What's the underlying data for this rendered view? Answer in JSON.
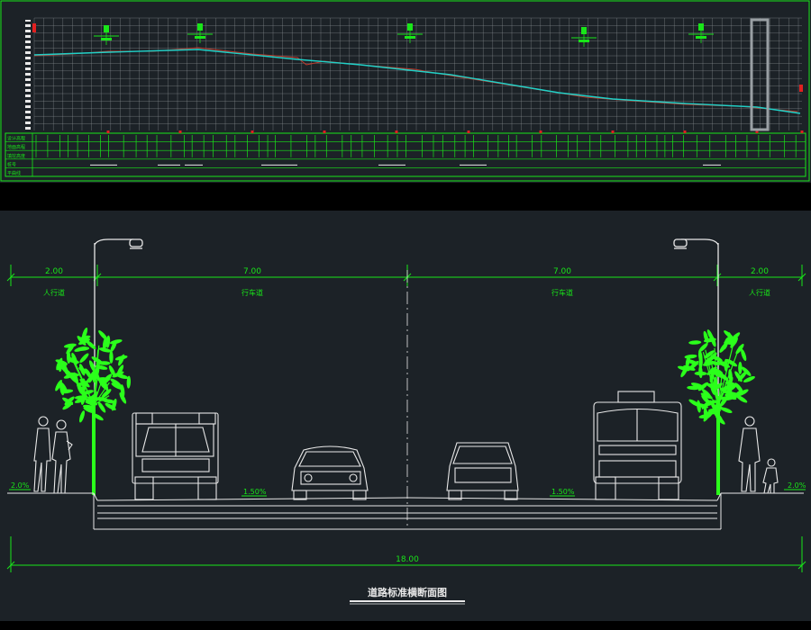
{
  "colors": {
    "background": "#1c2227",
    "drawing_green": "#19e619",
    "tree_green": "#2bff1b",
    "line_white": "#e8e8e8",
    "grid": "#8a8f93",
    "profile_line": "#1fd1c8",
    "design_line": "#c0392b"
  },
  "section": {
    "widths": [
      {
        "value": "2.00",
        "zone": "人行道"
      },
      {
        "value": "7.00",
        "zone": "行车道"
      },
      {
        "value": "7.00",
        "zone": "行车道"
      },
      {
        "value": "2.00",
        "zone": "人行道"
      }
    ],
    "total_width": "18.00",
    "slopes": {
      "left_sidewalk": "2.0%",
      "left_lane": "1.50%",
      "right_lane": "1.50%",
      "right_sidewalk": "2.0%"
    },
    "title": "道路标准横断面图"
  },
  "profile": {
    "row_labels": [
      "设计高程",
      "地面高程",
      "填挖高度",
      "桩号",
      "平曲线"
    ]
  }
}
